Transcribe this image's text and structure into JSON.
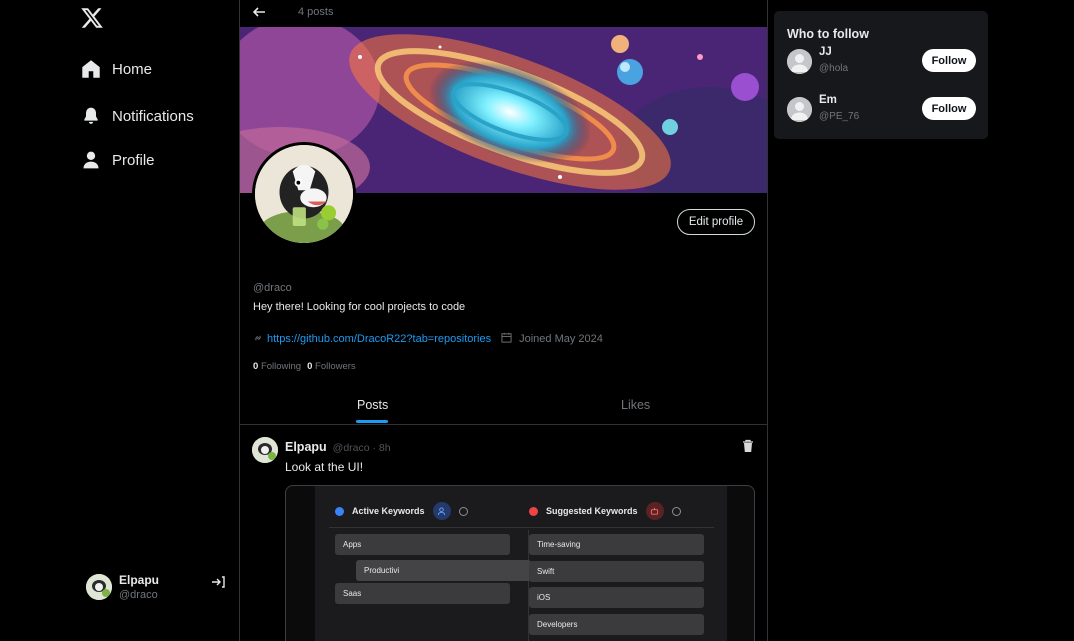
{
  "nav": {
    "items": [
      {
        "label": "Home",
        "icon": "home-icon"
      },
      {
        "label": "Notifications",
        "icon": "bell-icon"
      },
      {
        "label": "Profile",
        "icon": "user-icon"
      }
    ]
  },
  "account": {
    "name": "Elpapu",
    "handle": "@draco"
  },
  "header": {
    "post_count": "4 posts"
  },
  "profile": {
    "edit_label": "Edit profile",
    "handle": "@draco",
    "bio": "Hey there! Looking for cool projects to code",
    "link": "https://github.com/DracoR22?tab=repositories",
    "joined": "Joined May 2024",
    "following_count": "0",
    "following_label": "Following",
    "followers_count": "0",
    "followers_label": "Followers"
  },
  "tabs": [
    {
      "label": "Posts",
      "active": true
    },
    {
      "label": "Likes",
      "active": false
    }
  ],
  "post": {
    "author": "Elpapu",
    "handle_time": "@draco · 8h",
    "text": "Look at the UI!",
    "media": {
      "active_title": "Active Keywords",
      "suggested_title": "Suggested Keywords",
      "active_items": [
        "Apps",
        "Productivi",
        "Saas"
      ],
      "suggested_items": [
        "Time-saving",
        "Swift",
        "iOS",
        "Developers"
      ]
    }
  },
  "who_to_follow": {
    "title": "Who to follow",
    "users": [
      {
        "name": "JJ",
        "handle": "@hola",
        "button": "Follow"
      },
      {
        "name": "Em",
        "handle": "@PE_76",
        "button": "Follow"
      }
    ]
  },
  "colors": {
    "accent": "#1d9bf0",
    "background": "#000000",
    "card": "#16181c"
  }
}
